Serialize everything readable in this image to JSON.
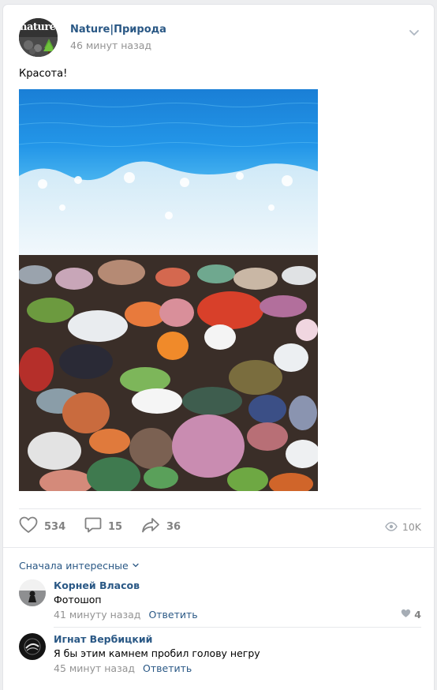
{
  "post": {
    "group_name": "Nature|Природа",
    "time": "46 минут назад",
    "text": "Красота!",
    "avatar_text": "nature",
    "photo_signature": "colorful pebbles",
    "likes": "534",
    "comments": "15",
    "shares": "36",
    "views": "10K"
  },
  "comments_section": {
    "sort_label": "Сначала интересные",
    "items": [
      {
        "author": "Корней Власов",
        "text": "Фотошоп",
        "time": "41 минуту назад",
        "reply_label": "Ответить",
        "likes": "4"
      },
      {
        "author": "Игнат Вербицкий",
        "text": "Я бы этим камнем пробил голову негру",
        "time": "45 минут назад",
        "reply_label": "Ответить",
        "likes": ""
      }
    ]
  },
  "colors": {
    "link": "#2a5885",
    "muted": "#939393",
    "icon": "#828282",
    "background": "#edeef0"
  },
  "icons": [
    "chevron-down-icon",
    "heart-icon",
    "comment-icon",
    "share-icon",
    "eye-icon"
  ]
}
